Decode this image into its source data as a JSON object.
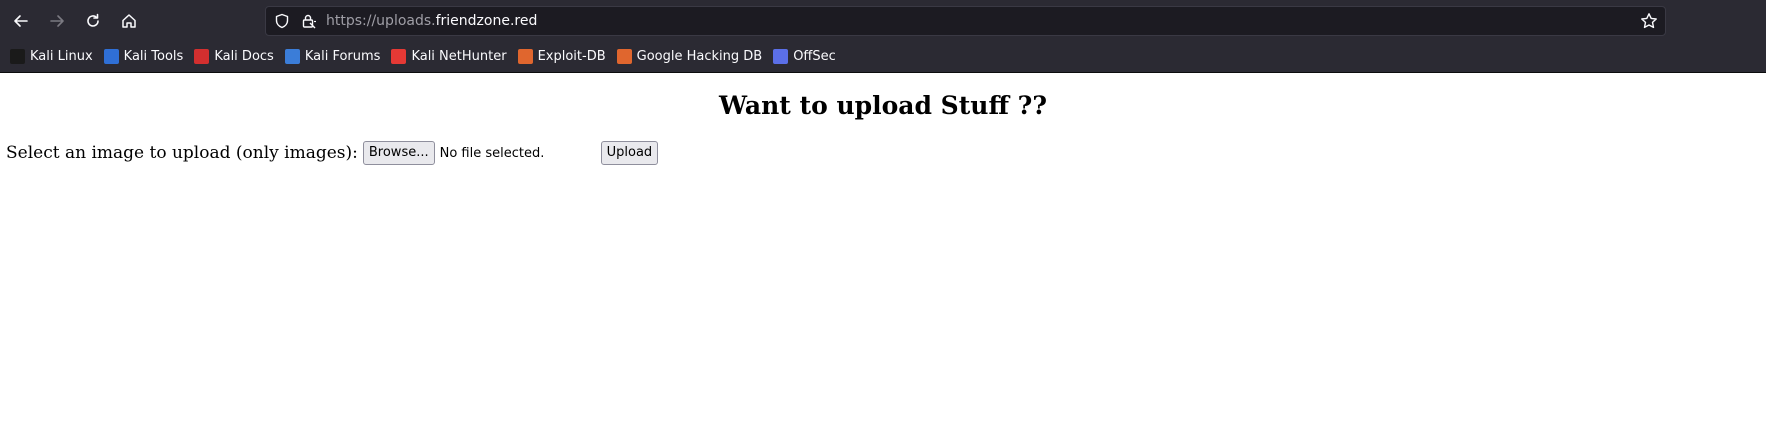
{
  "browser": {
    "url_prefix": "https://uploads.",
    "url_domain": "friendzone.red",
    "bookmarks": [
      {
        "label": "Kali Linux",
        "icon": "kali-dragon-icon",
        "color": "#1a1a1a"
      },
      {
        "label": "Kali Tools",
        "icon": "kali-tools-icon",
        "color": "#2f6fd6"
      },
      {
        "label": "Kali Docs",
        "icon": "kali-docs-icon",
        "color": "#d32f2f"
      },
      {
        "label": "Kali Forums",
        "icon": "kali-forums-icon",
        "color": "#3b7dd8"
      },
      {
        "label": "Kali NetHunter",
        "icon": "kali-nethunter-icon",
        "color": "#e53935"
      },
      {
        "label": "Exploit-DB",
        "icon": "exploit-db-icon",
        "color": "#e0662e"
      },
      {
        "label": "Google Hacking DB",
        "icon": "ghdb-icon",
        "color": "#e0662e"
      },
      {
        "label": "OffSec",
        "icon": "offsec-icon",
        "color": "#5b6fe8"
      }
    ]
  },
  "page": {
    "title": "Want to upload Stuff ??",
    "upload_label": "Select an image to upload (only images):",
    "browse_label": "Browse...",
    "file_status": "No file selected.",
    "upload_button": "Upload"
  }
}
